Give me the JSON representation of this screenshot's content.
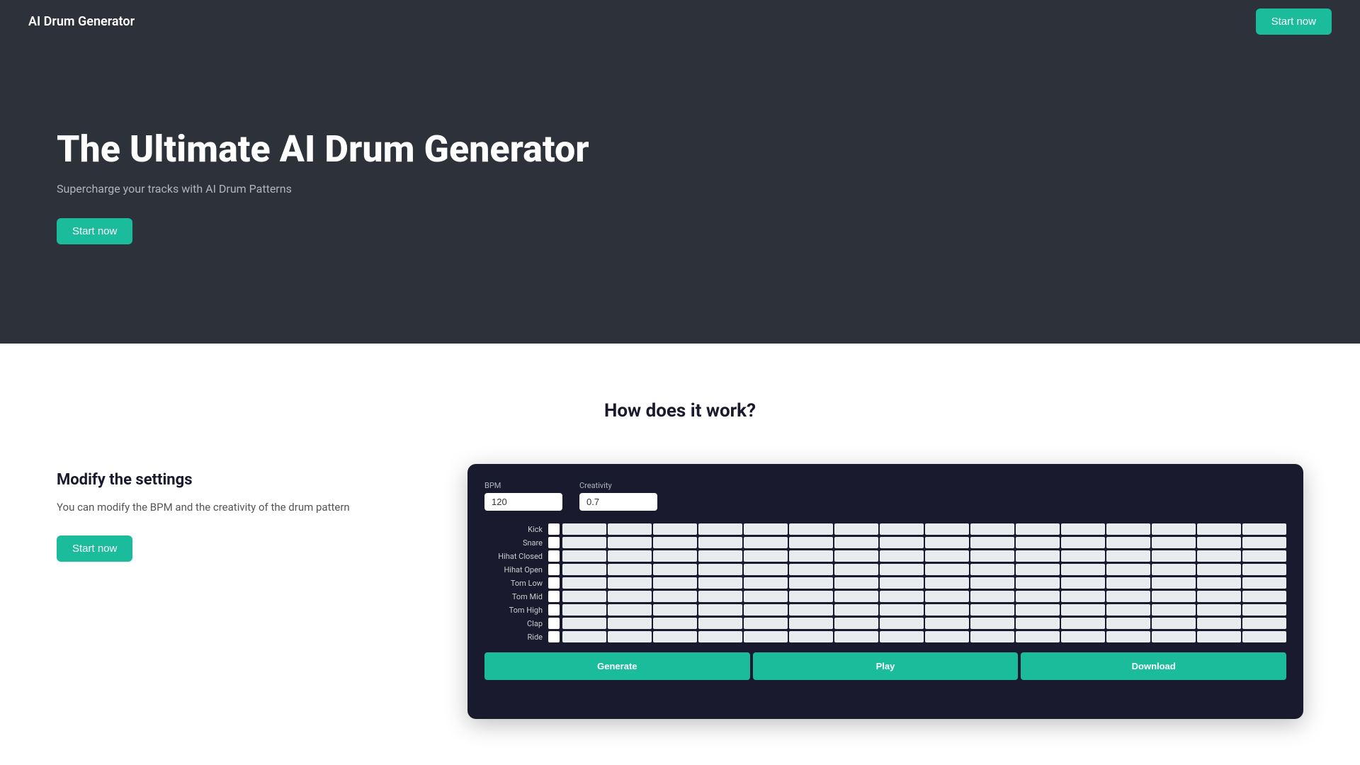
{
  "navbar": {
    "logo": "AI Drum Generator",
    "cta_label": "Start now"
  },
  "hero": {
    "title": "The Ultimate AI Drum Generator",
    "subtitle": "Supercharge your tracks with AI Drum Patterns",
    "cta_label": "Start now"
  },
  "how_section": {
    "title": "How does it work?",
    "modify_title": "Modify the settings",
    "modify_desc": "You can modify the BPM and the creativity of the drum pattern",
    "cta_label": "Start now"
  },
  "drum_machine": {
    "bpm_label": "BPM",
    "bpm_value": "120",
    "creativity_label": "Creativity",
    "creativity_value": "0.7",
    "rows": [
      {
        "label": "Kick"
      },
      {
        "label": "Snare"
      },
      {
        "label": "Hihat Closed"
      },
      {
        "label": "Hihat Open"
      },
      {
        "label": "Tom Low"
      },
      {
        "label": "Tom Mid"
      },
      {
        "label": "Tom High"
      },
      {
        "label": "Clap"
      },
      {
        "label": "Ride"
      }
    ],
    "generate_label": "Generate",
    "play_label": "Play",
    "download_label": "Download"
  }
}
